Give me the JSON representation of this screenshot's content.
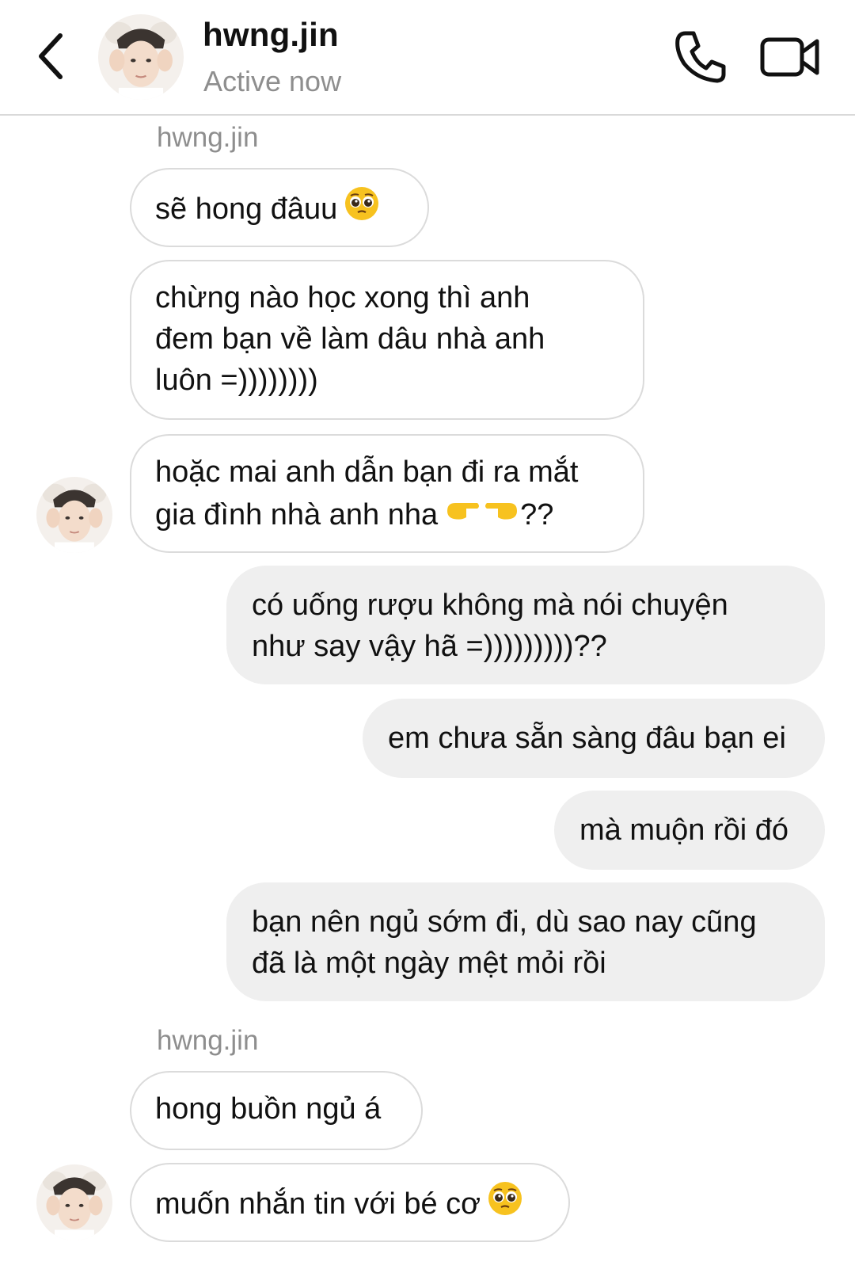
{
  "header": {
    "back_icon": "chevron-left-icon",
    "contact_name": "hwng.jin",
    "status": "Active now",
    "call_icon": "phone-icon",
    "video_icon": "video-camera-icon"
  },
  "messages": {
    "sender_label_1": "hwng.jin",
    "m1": "sẽ hong đâuu",
    "m2_line1": "chừng nào học xong thì anh",
    "m2_line2": "đem bạn về làm dâu nhà anh",
    "m2_line3": "luôn =))))))))",
    "m3_line1": "hoặc mai anh dẫn bạn đi ra mắt",
    "m3_line2": "gia đình nhà anh nha",
    "m3_suffix": "??",
    "m4_line1": "có uống rượu không mà nói chuyện",
    "m4_line2": "như say vậy hã =)))))))))??",
    "m5": "em chưa sẵn sàng đâu bạn ei",
    "m6": "mà muộn rồi đó",
    "m7_line1": "bạn nên ngủ sớm đi, dù sao nay cũng",
    "m7_line2": "đã là một ngày mệt mỏi rồi",
    "sender_label_2": "hwng.jin",
    "m8": "hong buồn ngủ á",
    "m9": "muốn nhắn tin với bé cơ"
  },
  "emoji": {
    "pleading": "pleading-face-icon",
    "pointing": "pointing-fingers-icon"
  },
  "colors": {
    "outgoing_bubble": "#efefef",
    "incoming_border": "#dbdbdb",
    "secondary_text": "#8e8e8e"
  }
}
